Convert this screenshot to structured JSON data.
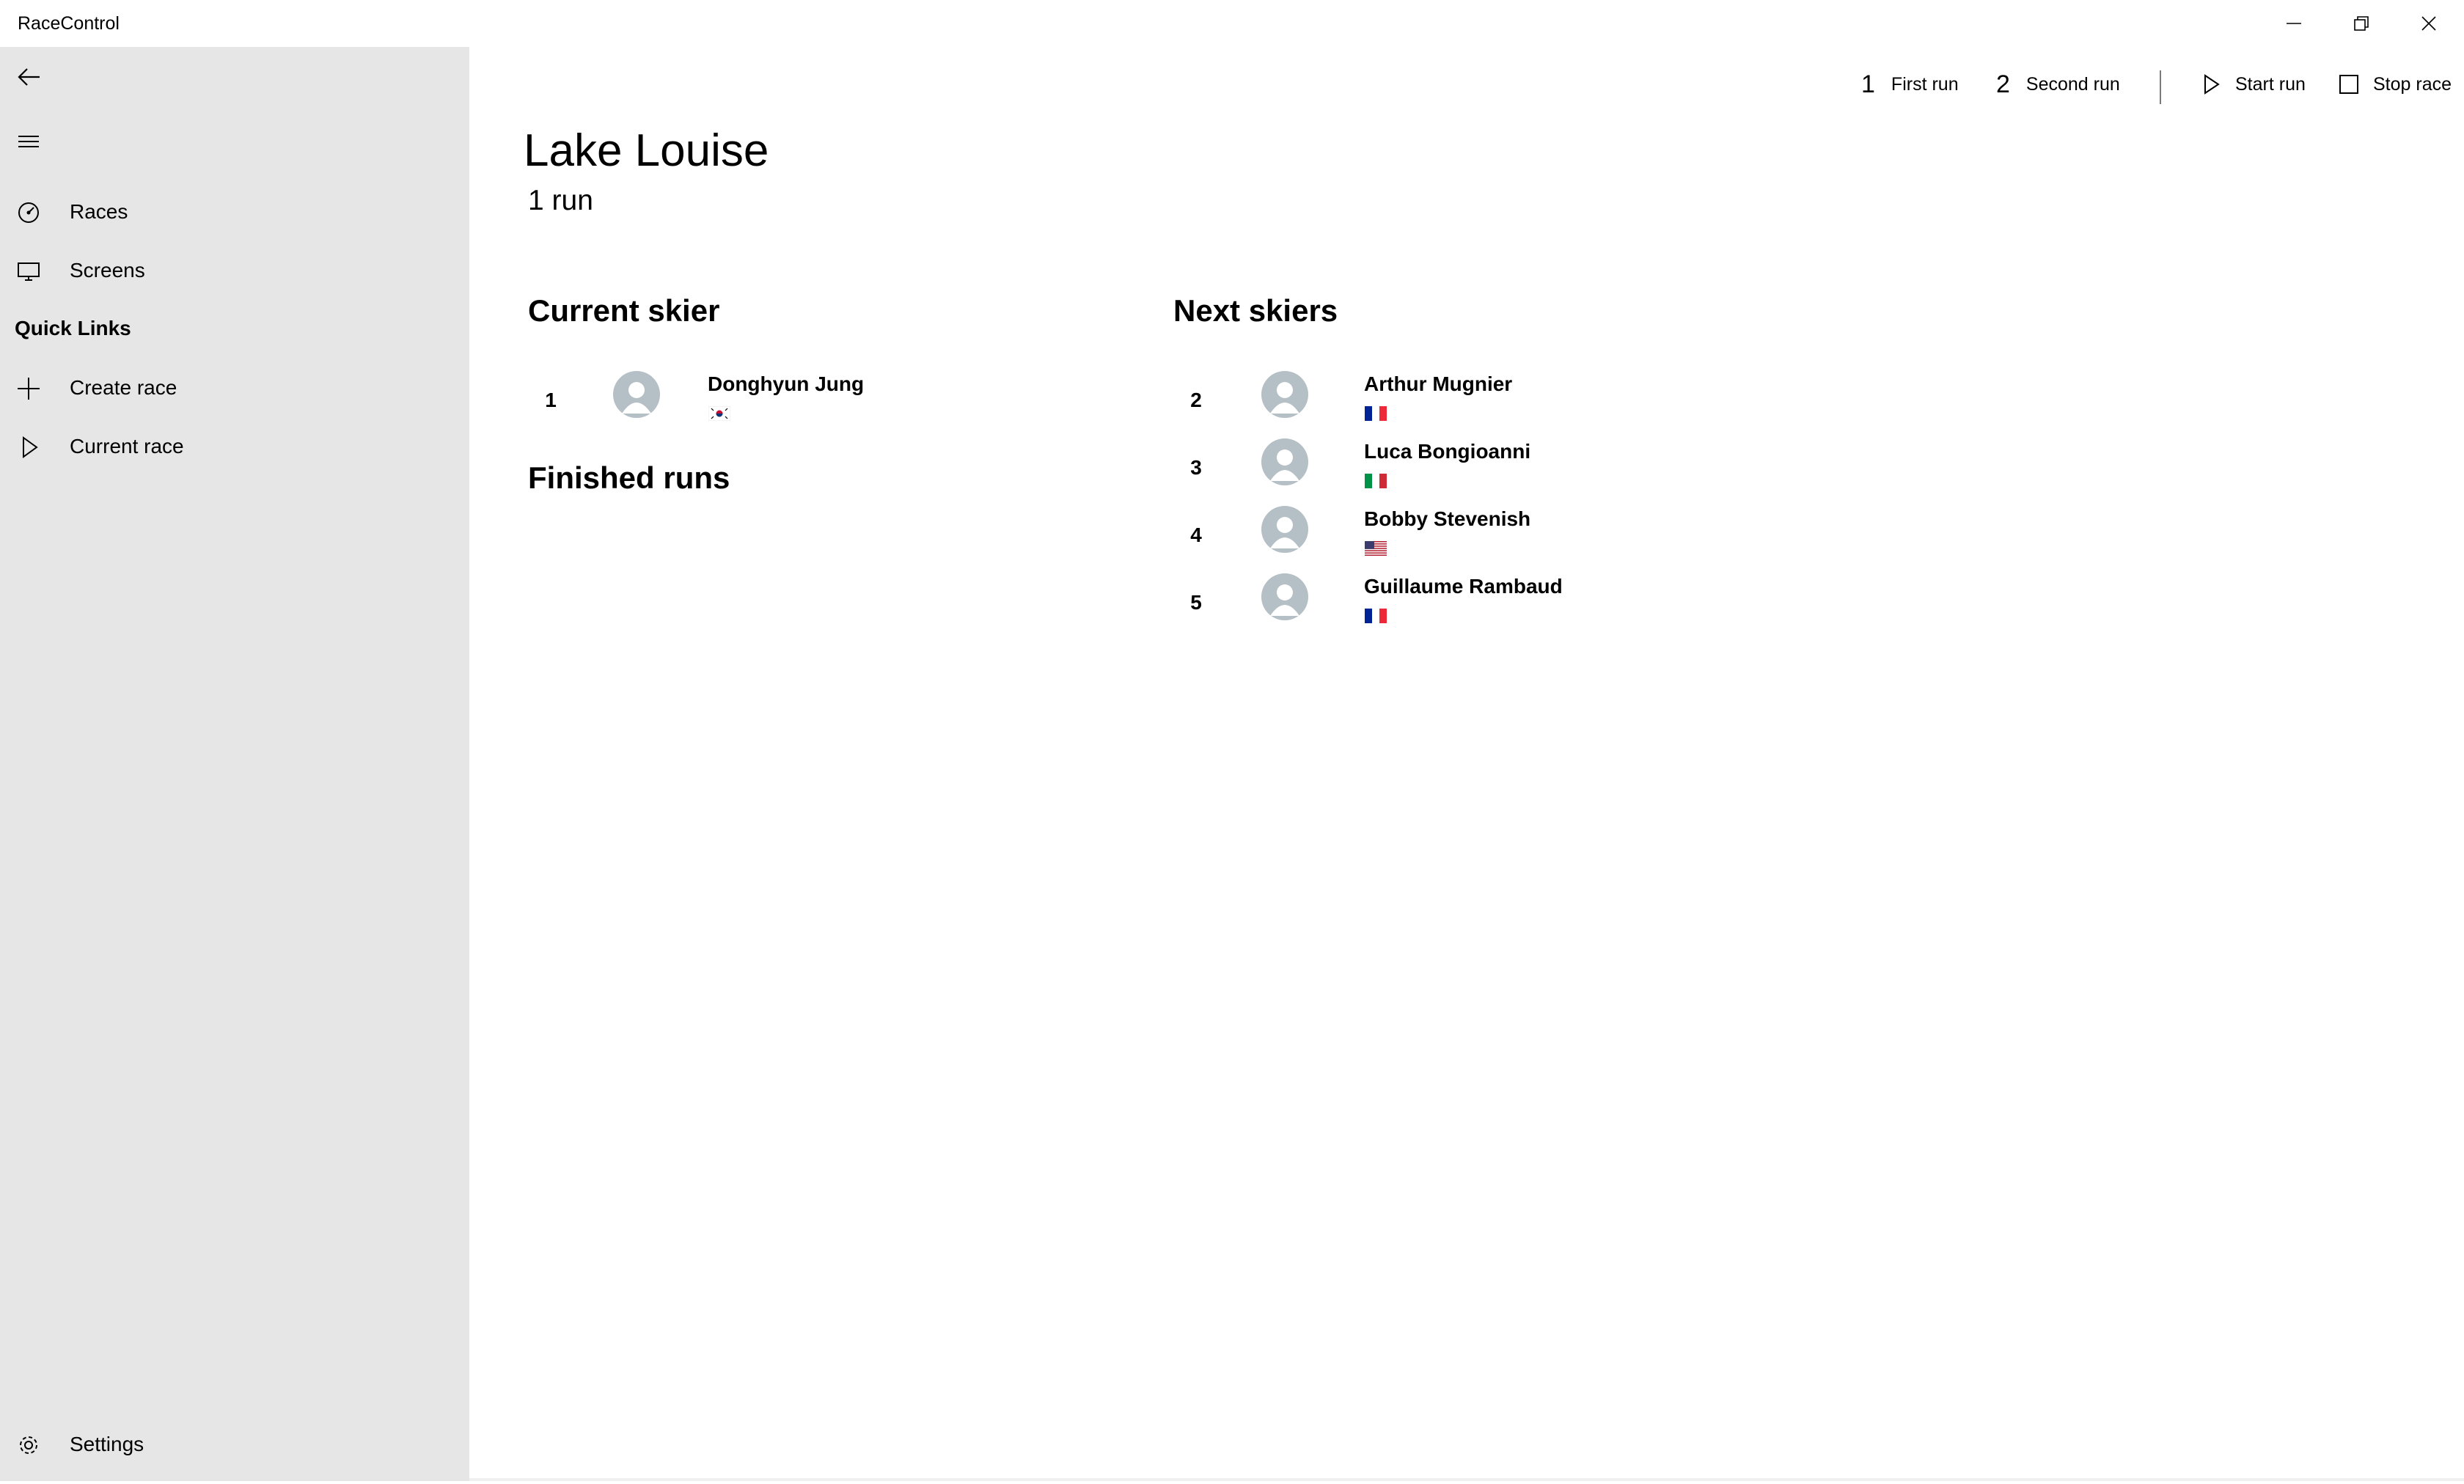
{
  "window": {
    "title": "RaceControl"
  },
  "sidebar": {
    "items": [
      {
        "label": "Races",
        "icon": "speedometer-icon"
      },
      {
        "label": "Screens",
        "icon": "monitor-icon"
      }
    ],
    "quick_links_label": "Quick Links",
    "quick_links": [
      {
        "label": "Create race",
        "icon": "plus-icon"
      },
      {
        "label": "Current race",
        "icon": "play-icon"
      }
    ],
    "settings_label": "Settings"
  },
  "command_bar": {
    "first_run_number": "1",
    "first_run_label": "First run",
    "second_run_number": "2",
    "second_run_label": "Second run",
    "start_run_label": "Start run",
    "stop_race_label": "Stop race"
  },
  "race": {
    "title": "Lake Louise",
    "subtitle": "1 run"
  },
  "current_skier": {
    "heading": "Current skier",
    "skier": {
      "number": "1",
      "name": "Donghyun Jung",
      "country": "KOR"
    }
  },
  "finished_runs": {
    "heading": "Finished runs"
  },
  "next_skiers": {
    "heading": "Next skiers",
    "skiers": [
      {
        "number": "2",
        "name": "Arthur Mugnier",
        "country": "FRA"
      },
      {
        "number": "3",
        "name": "Luca Bongioanni",
        "country": "ITA"
      },
      {
        "number": "4",
        "name": "Bobby Stevenish",
        "country": "USA"
      },
      {
        "number": "5",
        "name": "Guillaume Rambaud",
        "country": "FRA"
      }
    ]
  },
  "colors": {
    "sidebar_bg": "#e6e6e6",
    "avatar_bg": "#b5bfc6"
  }
}
